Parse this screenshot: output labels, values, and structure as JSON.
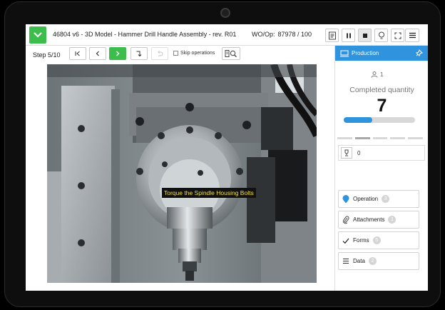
{
  "header": {
    "title": "46804 v6 - 3D Model - Hammer Drill Handle Assembly - rev. R01",
    "wo_label": "WO/Op:",
    "wo_value": "87978 / 100"
  },
  "stepbar": {
    "step_label": "Step 5/10",
    "skip_label": "Skip operations",
    "skip_checked": false
  },
  "image": {
    "caption": "Torque the Spindle Housing Bolts"
  },
  "panel": {
    "title": "Production",
    "operators": "1",
    "completed_label": "Completed quantity",
    "completed_value": "7",
    "progress": 0.4,
    "segments_active": 2,
    "trophy_value": "0",
    "tiles": [
      {
        "label": "Operation",
        "count": "3",
        "icon": "location-pin-icon"
      },
      {
        "label": "Attachments",
        "count": "1",
        "icon": "paperclip-icon"
      },
      {
        "label": "Forms",
        "count": "5",
        "icon": "checkmark-icon"
      },
      {
        "label": "Data",
        "count": "2",
        "icon": "list-icon"
      }
    ]
  },
  "colors": {
    "accent_blue": "#2f93dd",
    "accent_green": "#3dbe4c",
    "caption_text": "#f4e23a"
  }
}
